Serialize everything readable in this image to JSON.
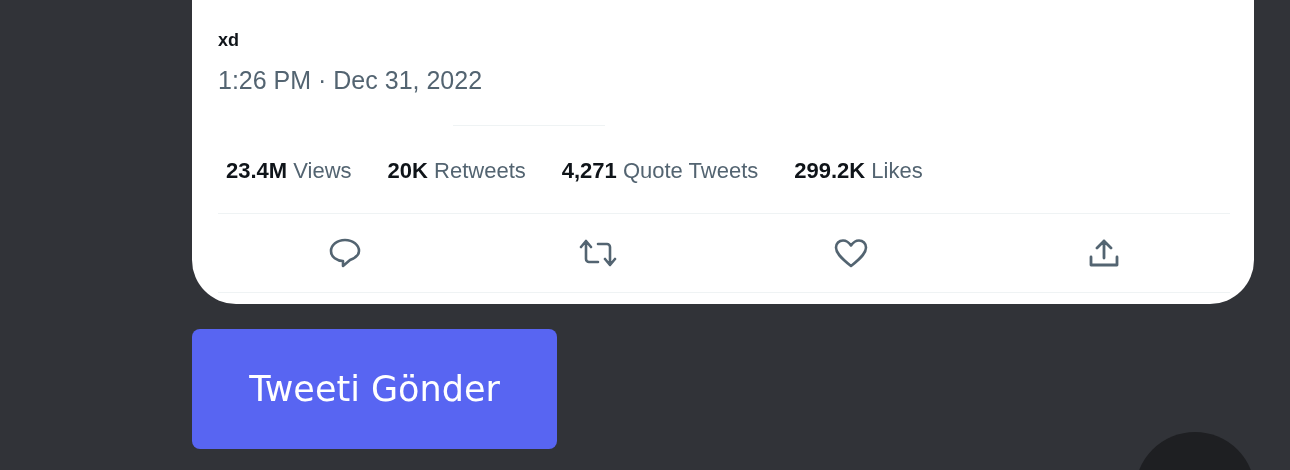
{
  "tweet": {
    "text": "xd",
    "timestamp": "1:26 PM · Dec 31, 2022",
    "stats": [
      "**23.4M** Views",
      "**20K** Retweets",
      "**4,271** Quote Tweets",
      "**299.2K** Likes"
    ]
  },
  "button": {
    "label": "Tweeti Gönder"
  }
}
